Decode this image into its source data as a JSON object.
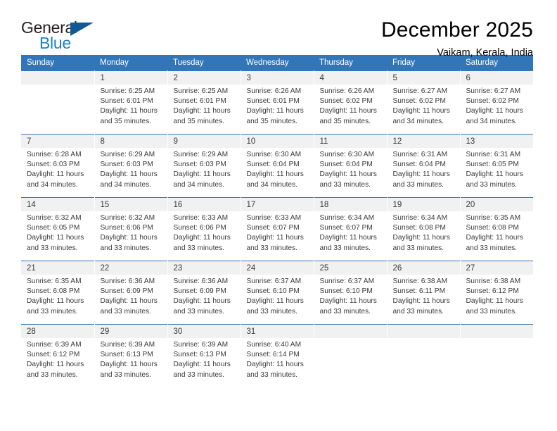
{
  "brand": {
    "name_part1": "General",
    "name_part2": "Blue",
    "flag_icon": "triangle-flag-icon",
    "accent_color": "#1e7fc4",
    "flag_color": "#125a96"
  },
  "header": {
    "month_title": "December 2025",
    "location": "Vaikam, Kerala, India"
  },
  "theme": {
    "header_row_bg": "#3076b8",
    "daynum_band_bg": "#f1f1f1",
    "text_color": "#3a3a3a",
    "row_divider": "#3076b8"
  },
  "weekdays": [
    "Sunday",
    "Monday",
    "Tuesday",
    "Wednesday",
    "Thursday",
    "Friday",
    "Saturday"
  ],
  "labels": {
    "sunrise_prefix": "Sunrise:",
    "sunset_prefix": "Sunset:",
    "daylight_prefix": "Daylight:"
  },
  "weeks": [
    [
      {
        "day": "",
        "sunrise": "",
        "sunset": "",
        "daylight": "",
        "blank": true
      },
      {
        "day": "1",
        "sunrise": "Sunrise: 6:25 AM",
        "sunset": "Sunset: 6:01 PM",
        "daylight": "Daylight: 11 hours and 35 minutes."
      },
      {
        "day": "2",
        "sunrise": "Sunrise: 6:25 AM",
        "sunset": "Sunset: 6:01 PM",
        "daylight": "Daylight: 11 hours and 35 minutes."
      },
      {
        "day": "3",
        "sunrise": "Sunrise: 6:26 AM",
        "sunset": "Sunset: 6:01 PM",
        "daylight": "Daylight: 11 hours and 35 minutes."
      },
      {
        "day": "4",
        "sunrise": "Sunrise: 6:26 AM",
        "sunset": "Sunset: 6:02 PM",
        "daylight": "Daylight: 11 hours and 35 minutes."
      },
      {
        "day": "5",
        "sunrise": "Sunrise: 6:27 AM",
        "sunset": "Sunset: 6:02 PM",
        "daylight": "Daylight: 11 hours and 34 minutes."
      },
      {
        "day": "6",
        "sunrise": "Sunrise: 6:27 AM",
        "sunset": "Sunset: 6:02 PM",
        "daylight": "Daylight: 11 hours and 34 minutes."
      }
    ],
    [
      {
        "day": "7",
        "sunrise": "Sunrise: 6:28 AM",
        "sunset": "Sunset: 6:03 PM",
        "daylight": "Daylight: 11 hours and 34 minutes."
      },
      {
        "day": "8",
        "sunrise": "Sunrise: 6:29 AM",
        "sunset": "Sunset: 6:03 PM",
        "daylight": "Daylight: 11 hours and 34 minutes."
      },
      {
        "day": "9",
        "sunrise": "Sunrise: 6:29 AM",
        "sunset": "Sunset: 6:03 PM",
        "daylight": "Daylight: 11 hours and 34 minutes."
      },
      {
        "day": "10",
        "sunrise": "Sunrise: 6:30 AM",
        "sunset": "Sunset: 6:04 PM",
        "daylight": "Daylight: 11 hours and 34 minutes."
      },
      {
        "day": "11",
        "sunrise": "Sunrise: 6:30 AM",
        "sunset": "Sunset: 6:04 PM",
        "daylight": "Daylight: 11 hours and 33 minutes."
      },
      {
        "day": "12",
        "sunrise": "Sunrise: 6:31 AM",
        "sunset": "Sunset: 6:04 PM",
        "daylight": "Daylight: 11 hours and 33 minutes."
      },
      {
        "day": "13",
        "sunrise": "Sunrise: 6:31 AM",
        "sunset": "Sunset: 6:05 PM",
        "daylight": "Daylight: 11 hours and 33 minutes."
      }
    ],
    [
      {
        "day": "14",
        "sunrise": "Sunrise: 6:32 AM",
        "sunset": "Sunset: 6:05 PM",
        "daylight": "Daylight: 11 hours and 33 minutes."
      },
      {
        "day": "15",
        "sunrise": "Sunrise: 6:32 AM",
        "sunset": "Sunset: 6:06 PM",
        "daylight": "Daylight: 11 hours and 33 minutes."
      },
      {
        "day": "16",
        "sunrise": "Sunrise: 6:33 AM",
        "sunset": "Sunset: 6:06 PM",
        "daylight": "Daylight: 11 hours and 33 minutes."
      },
      {
        "day": "17",
        "sunrise": "Sunrise: 6:33 AM",
        "sunset": "Sunset: 6:07 PM",
        "daylight": "Daylight: 11 hours and 33 minutes."
      },
      {
        "day": "18",
        "sunrise": "Sunrise: 6:34 AM",
        "sunset": "Sunset: 6:07 PM",
        "daylight": "Daylight: 11 hours and 33 minutes."
      },
      {
        "day": "19",
        "sunrise": "Sunrise: 6:34 AM",
        "sunset": "Sunset: 6:08 PM",
        "daylight": "Daylight: 11 hours and 33 minutes."
      },
      {
        "day": "20",
        "sunrise": "Sunrise: 6:35 AM",
        "sunset": "Sunset: 6:08 PM",
        "daylight": "Daylight: 11 hours and 33 minutes."
      }
    ],
    [
      {
        "day": "21",
        "sunrise": "Sunrise: 6:35 AM",
        "sunset": "Sunset: 6:08 PM",
        "daylight": "Daylight: 11 hours and 33 minutes."
      },
      {
        "day": "22",
        "sunrise": "Sunrise: 6:36 AM",
        "sunset": "Sunset: 6:09 PM",
        "daylight": "Daylight: 11 hours and 33 minutes."
      },
      {
        "day": "23",
        "sunrise": "Sunrise: 6:36 AM",
        "sunset": "Sunset: 6:09 PM",
        "daylight": "Daylight: 11 hours and 33 minutes."
      },
      {
        "day": "24",
        "sunrise": "Sunrise: 6:37 AM",
        "sunset": "Sunset: 6:10 PM",
        "daylight": "Daylight: 11 hours and 33 minutes."
      },
      {
        "day": "25",
        "sunrise": "Sunrise: 6:37 AM",
        "sunset": "Sunset: 6:10 PM",
        "daylight": "Daylight: 11 hours and 33 minutes."
      },
      {
        "day": "26",
        "sunrise": "Sunrise: 6:38 AM",
        "sunset": "Sunset: 6:11 PM",
        "daylight": "Daylight: 11 hours and 33 minutes."
      },
      {
        "day": "27",
        "sunrise": "Sunrise: 6:38 AM",
        "sunset": "Sunset: 6:12 PM",
        "daylight": "Daylight: 11 hours and 33 minutes."
      }
    ],
    [
      {
        "day": "28",
        "sunrise": "Sunrise: 6:39 AM",
        "sunset": "Sunset: 6:12 PM",
        "daylight": "Daylight: 11 hours and 33 minutes."
      },
      {
        "day": "29",
        "sunrise": "Sunrise: 6:39 AM",
        "sunset": "Sunset: 6:13 PM",
        "daylight": "Daylight: 11 hours and 33 minutes."
      },
      {
        "day": "30",
        "sunrise": "Sunrise: 6:39 AM",
        "sunset": "Sunset: 6:13 PM",
        "daylight": "Daylight: 11 hours and 33 minutes."
      },
      {
        "day": "31",
        "sunrise": "Sunrise: 6:40 AM",
        "sunset": "Sunset: 6:14 PM",
        "daylight": "Daylight: 11 hours and 33 minutes."
      },
      {
        "day": "",
        "sunrise": "",
        "sunset": "",
        "daylight": "",
        "blank": true
      },
      {
        "day": "",
        "sunrise": "",
        "sunset": "",
        "daylight": "",
        "blank": true
      },
      {
        "day": "",
        "sunrise": "",
        "sunset": "",
        "daylight": "",
        "blank": true
      }
    ]
  ]
}
